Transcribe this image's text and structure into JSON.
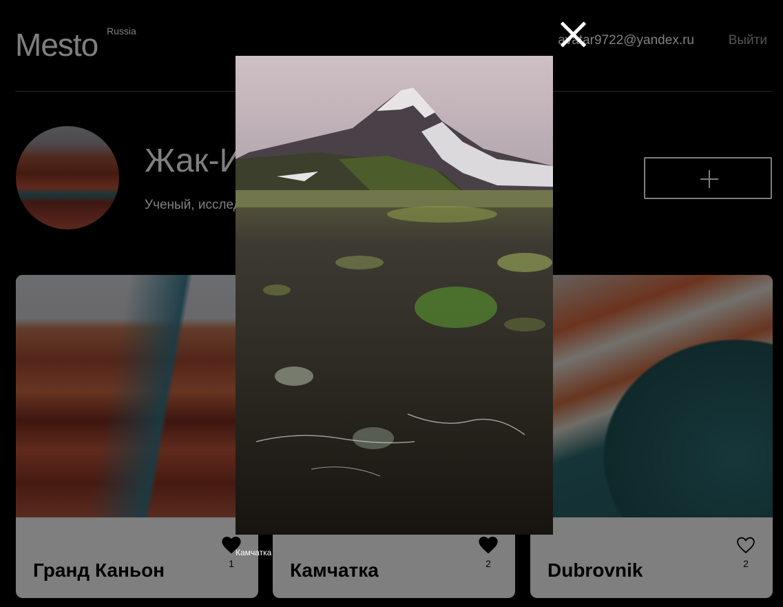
{
  "header": {
    "logo": "Mesto",
    "logo_sup": "Russia",
    "email": "avatar9722@yandex.ru",
    "logout": "Выйти"
  },
  "profile": {
    "name": "Жак-Ив Кусто",
    "about": "Ученый, исследователь"
  },
  "cards": [
    {
      "title": "Гранд Каньон",
      "likes": "1",
      "liked": true
    },
    {
      "title": "Камчатка",
      "likes": "2",
      "liked": true
    },
    {
      "title": "Dubrovnik",
      "likes": "2",
      "liked": false
    }
  ],
  "popup": {
    "caption": "Камчатка"
  },
  "colors": {
    "page_bg": "#000000",
    "overlay": "rgba(0,0,0,0.5)",
    "card_bg": "#ffffff",
    "logout": "#a9a9a9"
  },
  "icons": {
    "add": "plus-icon",
    "close": "close-icon",
    "like": "heart-icon",
    "delete": "trash-icon"
  }
}
